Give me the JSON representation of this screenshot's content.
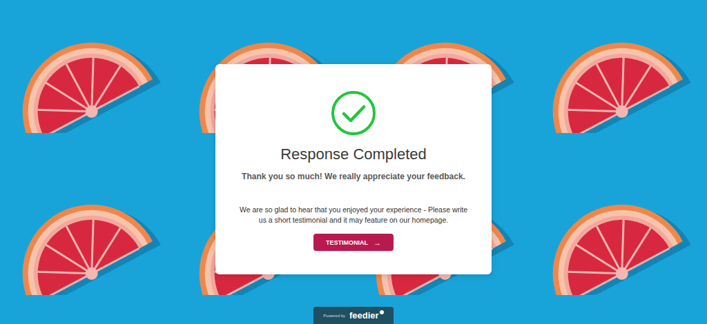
{
  "status": {
    "title": "Response Completed",
    "message": "Thank you so much! We really appreciate your feedback."
  },
  "prompt": "We are so glad to hear that you enjoyed your experience - Please write us a short testimonial and it may feature on our homepage.",
  "button": {
    "label": "TESTIMONIAL",
    "icon": "→"
  },
  "footer": {
    "prefix": "Powered by",
    "brand": "feedier"
  }
}
